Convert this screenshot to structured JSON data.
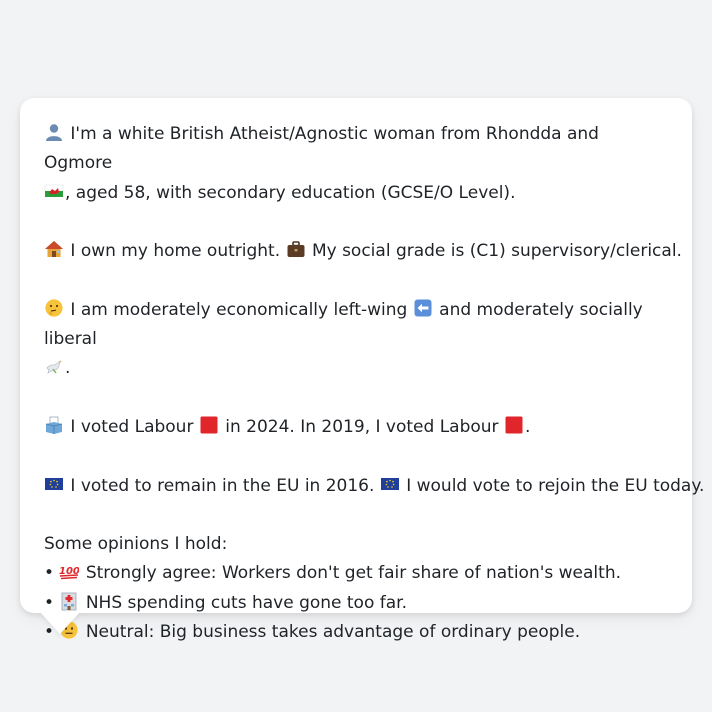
{
  "profile": {
    "identity_a": "I'm a white British Atheist/Agnostic woman from Rhondda and Ogmore",
    "identity_b": ", aged 58, with secondary education (GCSE/O Level).",
    "home": "I own my home outright.",
    "grade": "My social grade is (C1) supervisory/clerical.",
    "politics_a": "I am moderately economically left-wing",
    "politics_b": "and moderately socially liberal",
    "politics_c": ".",
    "vote_a": "I voted Labour",
    "vote_b": "in 2024. In 2019, I voted Labour",
    "vote_c": ".",
    "eu_a": "I voted to remain in the EU in 2016.",
    "eu_b": "I would vote to rejoin the EU today.",
    "opinions_heading": "Some opinions I hold:",
    "bullet": "•",
    "opinions": [
      "Strongly agree: Workers don't get fair share of nation's wealth.",
      "NHS spending cuts have gone too far.",
      "Neutral: Big business takes advantage of ordinary people."
    ]
  },
  "icons": {
    "person": "bust-in-silhouette-icon",
    "wales_flag": "wales-flag-icon",
    "house": "house-icon",
    "briefcase": "briefcase-icon",
    "thinking": "thinking-face-icon",
    "left_arrow": "left-arrow-icon",
    "dove": "dove-icon",
    "ballot": "ballot-box-icon",
    "red_square": "red-square-icon",
    "eu_flag": "eu-flag-icon",
    "hundred": "hundred-points-icon",
    "hospital": "hospital-icon",
    "neutral_face": "neutral-face-icon"
  },
  "colors": {
    "background": "#f2f3f5",
    "card": "#ffffff",
    "text": "#1f2328",
    "labour_red": "#e0262b",
    "eu_blue": "#1f3f9a"
  }
}
